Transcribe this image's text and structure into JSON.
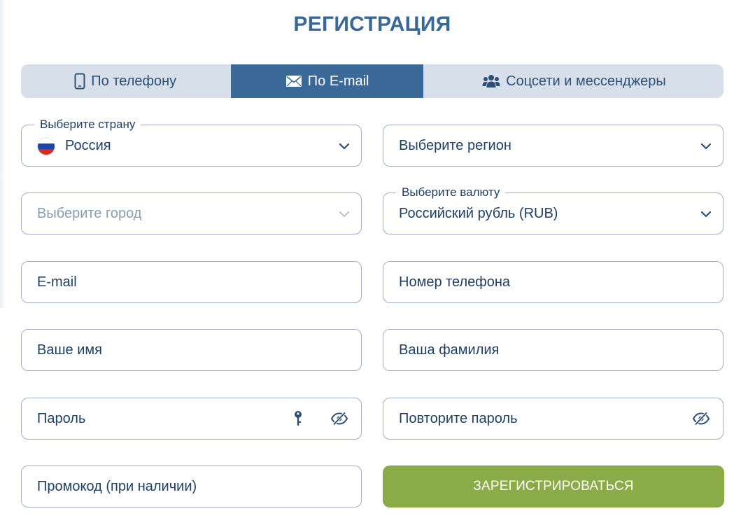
{
  "title": "РЕГИСТРАЦИЯ",
  "tabs": [
    {
      "label": "По телефону",
      "icon": "phone-icon",
      "active": false
    },
    {
      "label": "По E-mail",
      "icon": "envelope-icon",
      "active": true
    },
    {
      "label": "Соцсети и мессенджеры",
      "icon": "users-icon",
      "active": false
    }
  ],
  "fields": {
    "country": {
      "legend": "Выберите страну",
      "value": "Россия",
      "icon": "russia-flag-icon"
    },
    "region": {
      "value": "Выберите регион"
    },
    "city": {
      "value": "Выберите город"
    },
    "currency": {
      "legend": "Выберите валюту",
      "value": "Российский рубль (RUB)"
    },
    "email": {
      "placeholder": "E-mail"
    },
    "phone": {
      "placeholder": "Номер телефона"
    },
    "first_name": {
      "placeholder": "Ваше имя"
    },
    "last_name": {
      "placeholder": "Ваша фамилия"
    },
    "password": {
      "placeholder": "Пароль"
    },
    "password_repeat": {
      "placeholder": "Повторите пароль"
    },
    "promo": {
      "placeholder": "Промокод (при наличии)"
    }
  },
  "submit_label": "ЗАРЕГИСТРИРОВАТЬСЯ",
  "colors": {
    "accent": "#3a6897",
    "tab_inactive": "#d7e0ea",
    "submit": "#8aab48",
    "border": "#9fb2c6"
  }
}
